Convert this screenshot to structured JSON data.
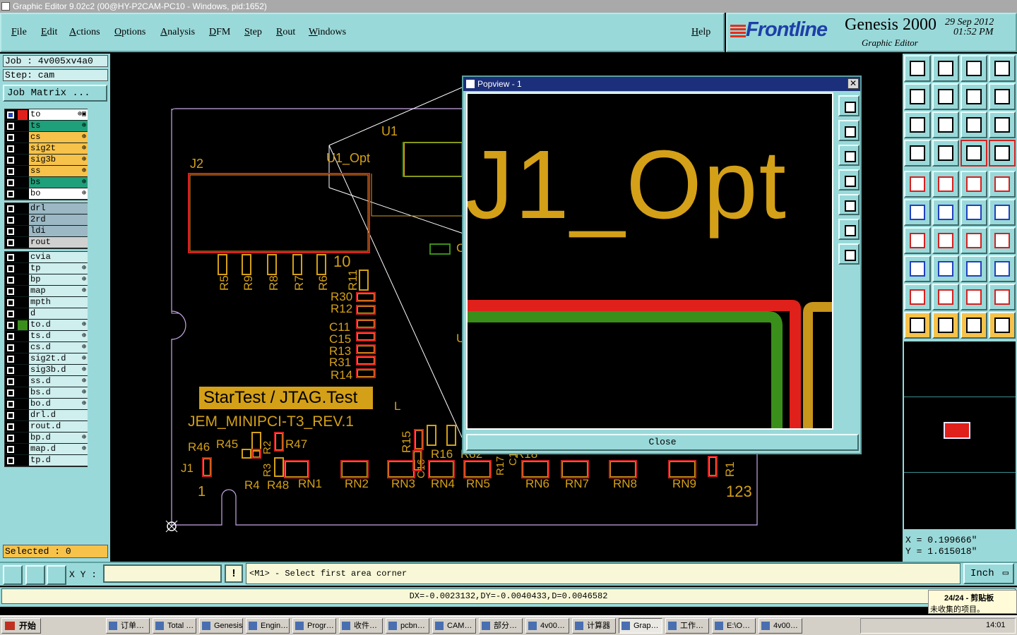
{
  "window": {
    "title": "Graphic Editor 9.02c2 (00@HY-P2CAM-PC10 - Windows, pid:1652)"
  },
  "menu": {
    "items": [
      "File",
      "Edit",
      "Actions",
      "Options",
      "Analysis",
      "DFM",
      "Step",
      "Rout",
      "Windows"
    ],
    "help": "Help"
  },
  "brand": {
    "logo": "Frontline",
    "product": "Genesis 2000",
    "subtitle": "Graphic Editor",
    "date": "29  Sep  2012",
    "time": "01:52  PM"
  },
  "job": {
    "job_label": "Job : 4v005xv4a0",
    "step_label": "Step: cam",
    "matrix_button": "Job Matrix ..."
  },
  "layers": {
    "group1": [
      {
        "name": "to",
        "color": "#ffffff",
        "marks": "⊕▣"
      },
      {
        "name": "ts",
        "color": "#1fa07a",
        "marks": "⊕"
      },
      {
        "name": "cs",
        "color": "#f6c24a",
        "marks": "⊕"
      },
      {
        "name": "sig2t",
        "color": "#f6c24a",
        "marks": "⊕"
      },
      {
        "name": "sig3b",
        "color": "#f6c24a",
        "marks": "⊕"
      },
      {
        "name": "ss",
        "color": "#f6c24a",
        "marks": "⊕"
      },
      {
        "name": "bs",
        "color": "#1fa07a",
        "marks": "⊕"
      },
      {
        "name": "bo",
        "color": "#ffffff",
        "marks": "⊕"
      }
    ],
    "group2": [
      {
        "name": "drl",
        "color": "#9bb8c4"
      },
      {
        "name": "2rd",
        "color": "#9bb8c4"
      },
      {
        "name": "ldi",
        "color": "#9bb8c4"
      },
      {
        "name": "rout",
        "color": "#d0d0d0"
      }
    ],
    "group3": [
      {
        "name": "cvia",
        "color": "#cfeeee",
        "marks": ""
      },
      {
        "name": "tp",
        "color": "#cfeeee",
        "marks": "⊕"
      },
      {
        "name": "bp",
        "color": "#cfeeee",
        "marks": "⊕"
      },
      {
        "name": "map",
        "color": "#cfeeee",
        "marks": "⊕"
      },
      {
        "name": "mpth",
        "color": "#cfeeee",
        "marks": ""
      },
      {
        "name": "d",
        "color": "#cfeeee",
        "marks": ""
      },
      {
        "name": "to.d",
        "color": "#cfeeee",
        "marks": "⊕"
      },
      {
        "name": "ts.d",
        "color": "#cfeeee",
        "marks": "⊕"
      },
      {
        "name": "cs.d",
        "color": "#cfeeee",
        "marks": "⊕"
      },
      {
        "name": "sig2t.d",
        "color": "#cfeeee",
        "marks": "⊕"
      },
      {
        "name": "sig3b.d",
        "color": "#cfeeee",
        "marks": "⊕"
      },
      {
        "name": "ss.d",
        "color": "#cfeeee",
        "marks": "⊕"
      },
      {
        "name": "bs.d",
        "color": "#cfeeee",
        "marks": "⊕"
      },
      {
        "name": "bo.d",
        "color": "#cfeeee",
        "marks": "⊕"
      },
      {
        "name": "drl.d",
        "color": "#cfeeee",
        "marks": ""
      },
      {
        "name": "rout.d",
        "color": "#cfeeee",
        "marks": ""
      },
      {
        "name": "bp.d",
        "color": "#cfeeee",
        "marks": "⊕"
      },
      {
        "name": "map.d",
        "color": "#cfeeee",
        "marks": "⊕"
      },
      {
        "name": "tp.d",
        "color": "#cfeeee",
        "marks": ""
      }
    ]
  },
  "selected": "Selected : 0",
  "board": {
    "labels": [
      "J2",
      "U1",
      "U1_Opt",
      "10",
      "R5",
      "R9",
      "R8",
      "R7",
      "R6",
      "R11",
      "R30",
      "R12",
      "C11",
      "C15",
      "R13",
      "R31",
      "R14",
      "R46",
      "R45",
      "R2",
      "R47",
      "J1",
      "1",
      "R3",
      "R4",
      "R48",
      "RN1",
      "RN2",
      "RN3",
      "RN4",
      "RN5",
      "RN6",
      "RN7",
      "RN8",
      "RN9",
      "R15",
      "R16",
      "C16",
      "R17",
      "C1",
      "R32",
      "R18",
      "R1",
      "123",
      "C",
      "U",
      "L"
    ],
    "silk_banner": "StarTest / JTAG.Test",
    "silk_text": "JEM_MINIPCI-T3_REV.1"
  },
  "popview": {
    "title": "Popview - 1",
    "zoom_text": "J1_Opt",
    "close_label": "Close",
    "close_x": "✕"
  },
  "coords": {
    "x": "X  = 0.199666\"",
    "y": "Y  = 1.615018\""
  },
  "prompt": {
    "xy_label": "X Y :",
    "xy_value": "",
    "warn": "!",
    "message": "<M1> - Select first area corner",
    "unit": "Inch"
  },
  "status": {
    "dx": "DX=-0.0023132,DY=-0.0040433,D=0.0046582"
  },
  "clipboard": {
    "count": "24/24 - 剪贴板",
    "text": "未收集的项目。"
  },
  "taskbar": {
    "start": "开始",
    "items": [
      "订单…",
      "Total …",
      "Genesis",
      "Engin…",
      "Progr…",
      "收件…",
      "pcbn…",
      "CAM…",
      "部分…",
      "4v00…",
      "计算器",
      "Grap…",
      "工作…",
      "E:\\O…",
      "4v00…"
    ],
    "clock": "14:01"
  },
  "colors": {
    "panel": "#9ad9d9",
    "gold": "#d4a017",
    "red": "#d62020",
    "green": "#3a8f1a"
  }
}
